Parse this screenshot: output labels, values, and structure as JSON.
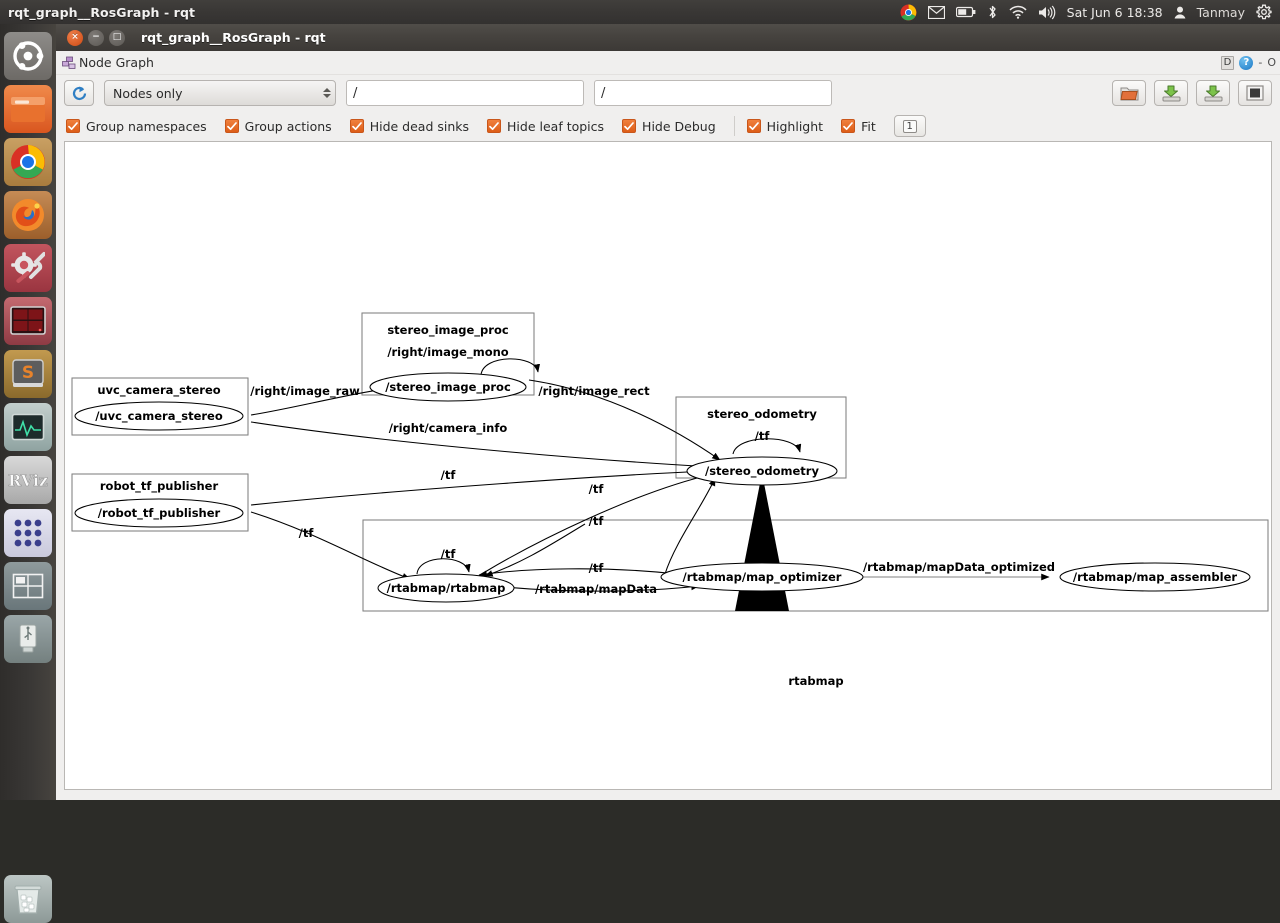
{
  "desktop": {
    "window_title": "rqt_graph__RosGraph - rqt",
    "tray": {
      "icons": [
        "chrome-icon",
        "mail-icon",
        "battery-icon",
        "bluetooth-icon",
        "wifi-icon",
        "volume-icon"
      ],
      "datetime": "Sat Jun 6 18:38",
      "user": "Tanmay",
      "gear": "gear-icon"
    },
    "launcher": [
      {
        "name": "ubuntu-dash",
        "label": "Ubuntu"
      },
      {
        "name": "files",
        "label": "Files"
      },
      {
        "name": "chrome",
        "label": "Google Chrome"
      },
      {
        "name": "firefox",
        "label": "Firefox"
      },
      {
        "name": "settings",
        "label": "System Settings"
      },
      {
        "name": "terminal",
        "label": "Terminal"
      },
      {
        "name": "sublime",
        "label": "S"
      },
      {
        "name": "system-monitor",
        "label": "System Monitor"
      },
      {
        "name": "rviz",
        "label": "RViz"
      },
      {
        "name": "app-grid",
        "label": "Applications"
      },
      {
        "name": "workspace-switcher",
        "label": "Workspace Switcher"
      },
      {
        "name": "usb-drive",
        "label": "USB Drive"
      },
      {
        "name": "trash",
        "label": "Trash"
      }
    ]
  },
  "window": {
    "title": "rqt_graph__RosGraph - rqt",
    "controls": {
      "close": "×",
      "minimize": "−",
      "maximize": "□"
    }
  },
  "panel": {
    "title": "Node Graph",
    "header_buttons": {
      "dock": "D",
      "help": "?",
      "minimize": "-",
      "close": "O"
    }
  },
  "toolbar": {
    "refresh_icon": "refresh-icon",
    "graph_type": "Nodes only",
    "filter_field": "/",
    "topic_field": "/",
    "filter_placeholder": "/",
    "topic_placeholder": "/",
    "right_buttons": [
      {
        "name": "load-dot-button",
        "icon": "folder-icon"
      },
      {
        "name": "save-dot-button",
        "icon": "save-dot-icon"
      },
      {
        "name": "save-image-button",
        "icon": "save-image-icon"
      },
      {
        "name": "fit-in-view-button",
        "icon": "fit-view-icon"
      }
    ],
    "checkboxes": [
      {
        "name": "group-namespaces",
        "label": "Group namespaces",
        "checked": true
      },
      {
        "name": "group-actions",
        "label": "Group actions",
        "checked": true
      },
      {
        "name": "hide-dead-sinks",
        "label": "Hide dead sinks",
        "checked": true
      },
      {
        "name": "hide-leaf-topics",
        "label": "Hide leaf topics",
        "checked": true
      },
      {
        "name": "hide-debug",
        "label": "Hide Debug",
        "checked": true
      },
      {
        "name": "highlight",
        "label": "Highlight",
        "checked": true
      },
      {
        "name": "fit",
        "label": "Fit",
        "checked": true
      }
    ],
    "zoom_button_label": "1"
  },
  "graph": {
    "clusters": [
      {
        "name": "stereo_image_proc",
        "label": "stereo_image_proc"
      },
      {
        "name": "stereo_odometry",
        "label": "stereo_odometry"
      },
      {
        "name": "rtabmap",
        "label": "rtabmap"
      },
      {
        "name": "uvc_camera_stereo",
        "label": "uvc_camera_stereo"
      },
      {
        "name": "robot_tf_publisher",
        "label": "robot_tf_publisher"
      }
    ],
    "nodes": [
      {
        "name": "uvc_camera_stereo",
        "label": "/uvc_camera_stereo"
      },
      {
        "name": "stereo_image_proc",
        "label": "/stereo_image_proc"
      },
      {
        "name": "robot_tf_publisher",
        "label": "/robot_tf_publisher"
      },
      {
        "name": "stereo_odometry",
        "label": "/stereo_odometry"
      },
      {
        "name": "rtabmap_rtabmap",
        "label": "/rtabmap/rtabmap"
      },
      {
        "name": "rtabmap_map_optimizer",
        "label": "/rtabmap/map_optimizer"
      },
      {
        "name": "rtabmap_map_assembler",
        "label": "/rtabmap/map_assembler"
      }
    ],
    "edges": [
      {
        "label": "/right/image_raw"
      },
      {
        "label": "/right/image_mono"
      },
      {
        "label": "/right/image_rect"
      },
      {
        "label": "/right/camera_info"
      },
      {
        "label": "/tf"
      },
      {
        "label": "/tf"
      },
      {
        "label": "/tf"
      },
      {
        "label": "/tf"
      },
      {
        "label": "/tf"
      },
      {
        "label": "/tf"
      },
      {
        "label": "/rtabmap/mapData"
      },
      {
        "label": "/rtabmap/mapData_optimized"
      }
    ],
    "edge_labels": {
      "right_image_raw": "/right/image_raw",
      "right_image_mono": "/right/image_mono",
      "right_image_rect": "/right/image_rect",
      "right_camera_info": "/right/camera_info",
      "tf_1": "/tf",
      "tf_2": "/tf",
      "tf_3": "/tf",
      "tf_4": "/tf",
      "tf_5": "/tf",
      "tf_6": "/tf",
      "mapdata": "/rtabmap/mapData",
      "mapdata_optimized": "/rtabmap/mapData_optimized"
    }
  },
  "colors": {
    "accent_orange": "#dd5d17",
    "panel_bg": "#f0efee",
    "canvas_bg": "#ffffff",
    "titlebar": "#46433f",
    "node_stroke": "#000000"
  }
}
